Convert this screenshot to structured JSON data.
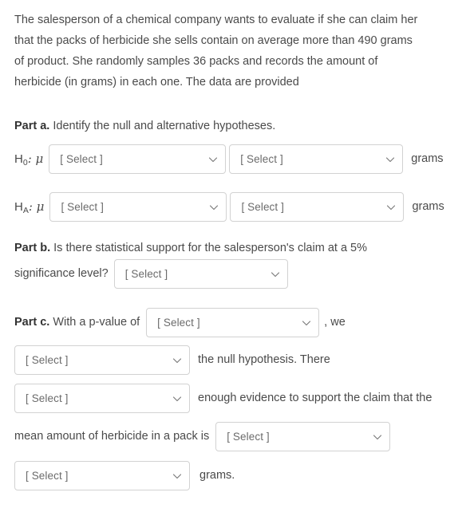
{
  "question": {
    "stem_lines": [
      "The salesperson of a chemical company wants to evaluate if she can claim her",
      "that the packs of herbicide she sells contain on average more than 490 grams",
      "of product. She randomly samples 36 packs and records the amount of",
      "herbicide (in grams) in each one. The data are provided"
    ]
  },
  "select_placeholder": "[ Select ]",
  "chevron_icon": "chevron-down-icon",
  "part_a": {
    "label": "Part a.",
    "prompt": " Identify the null and alternative hypotheses.",
    "null_hypothesis": {
      "symbol": "H",
      "subscript": "0",
      "colon_mu": ": μ",
      "operator_value": "[ Select ]",
      "number_value": "[ Select ]",
      "unit": "grams"
    },
    "alt_hypothesis": {
      "symbol": "H",
      "subscript": "A",
      "colon_mu": ": μ",
      "operator_value": "[ Select ]",
      "number_value": "[ Select ]",
      "unit": "grams"
    }
  },
  "part_b": {
    "label": "Part b.",
    "prompt_line1": " Is there statistical support for the salesperson's claim at a 5%",
    "prompt_line2": "significance level?",
    "answer_value": "[ Select ]"
  },
  "part_c": {
    "label": "Part c.",
    "prompt_lead": " With a p-value of",
    "pvalue_value": "[ Select ]",
    "after_pvalue": ", we",
    "decision_value": "[ Select ]",
    "after_decision": "the null hypothesis. There",
    "evidence_value": "[ Select ]",
    "after_evidence": "enough evidence to support the claim that the",
    "mean_lead": "mean amount of herbicide in a pack is",
    "mean_value": "[ Select ]",
    "final_value": "[ Select ]",
    "final_unit": "grams."
  },
  "colors": {
    "text": "#4a4a4a",
    "heading": "#333333",
    "border": "#d2d2d2",
    "placeholder": "#6b6b6b",
    "background": "#ffffff"
  }
}
